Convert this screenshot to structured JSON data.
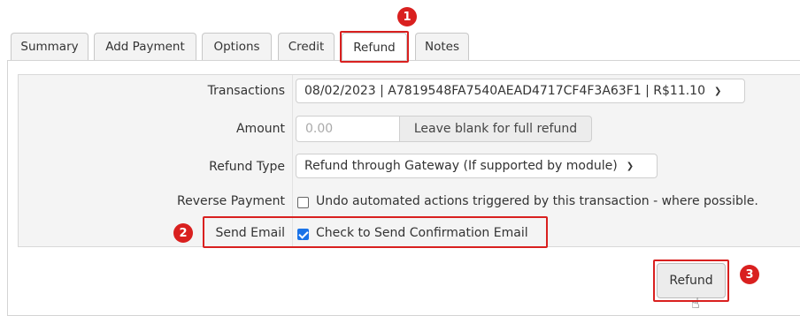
{
  "tabs": [
    {
      "label": "Summary"
    },
    {
      "label": "Add Payment"
    },
    {
      "label": "Options"
    },
    {
      "label": "Credit"
    },
    {
      "label": "Refund"
    },
    {
      "label": "Notes"
    }
  ],
  "active_tab": "Refund",
  "form": {
    "transactions": {
      "label": "Transactions",
      "value": "08/02/2023 | A7819548FA7540AEAD4717CF4F3A63F1 | R$11.10"
    },
    "amount": {
      "label": "Amount",
      "placeholder": "0.00",
      "addon": "Leave blank for full refund"
    },
    "refund_type": {
      "label": "Refund Type",
      "value": "Refund through Gateway (If supported by module)"
    },
    "reverse_payment": {
      "label": "Reverse Payment",
      "checkbox_label": "Undo automated actions triggered by this transaction - where possible.",
      "checked": false
    },
    "send_email": {
      "label": "Send Email",
      "checkbox_label": "Check to Send Confirmation Email",
      "checked": true
    }
  },
  "refund_button": {
    "label": "Refund"
  },
  "annotations": {
    "step1": "1",
    "step2": "2",
    "step3": "3",
    "color": "#d9201f"
  }
}
